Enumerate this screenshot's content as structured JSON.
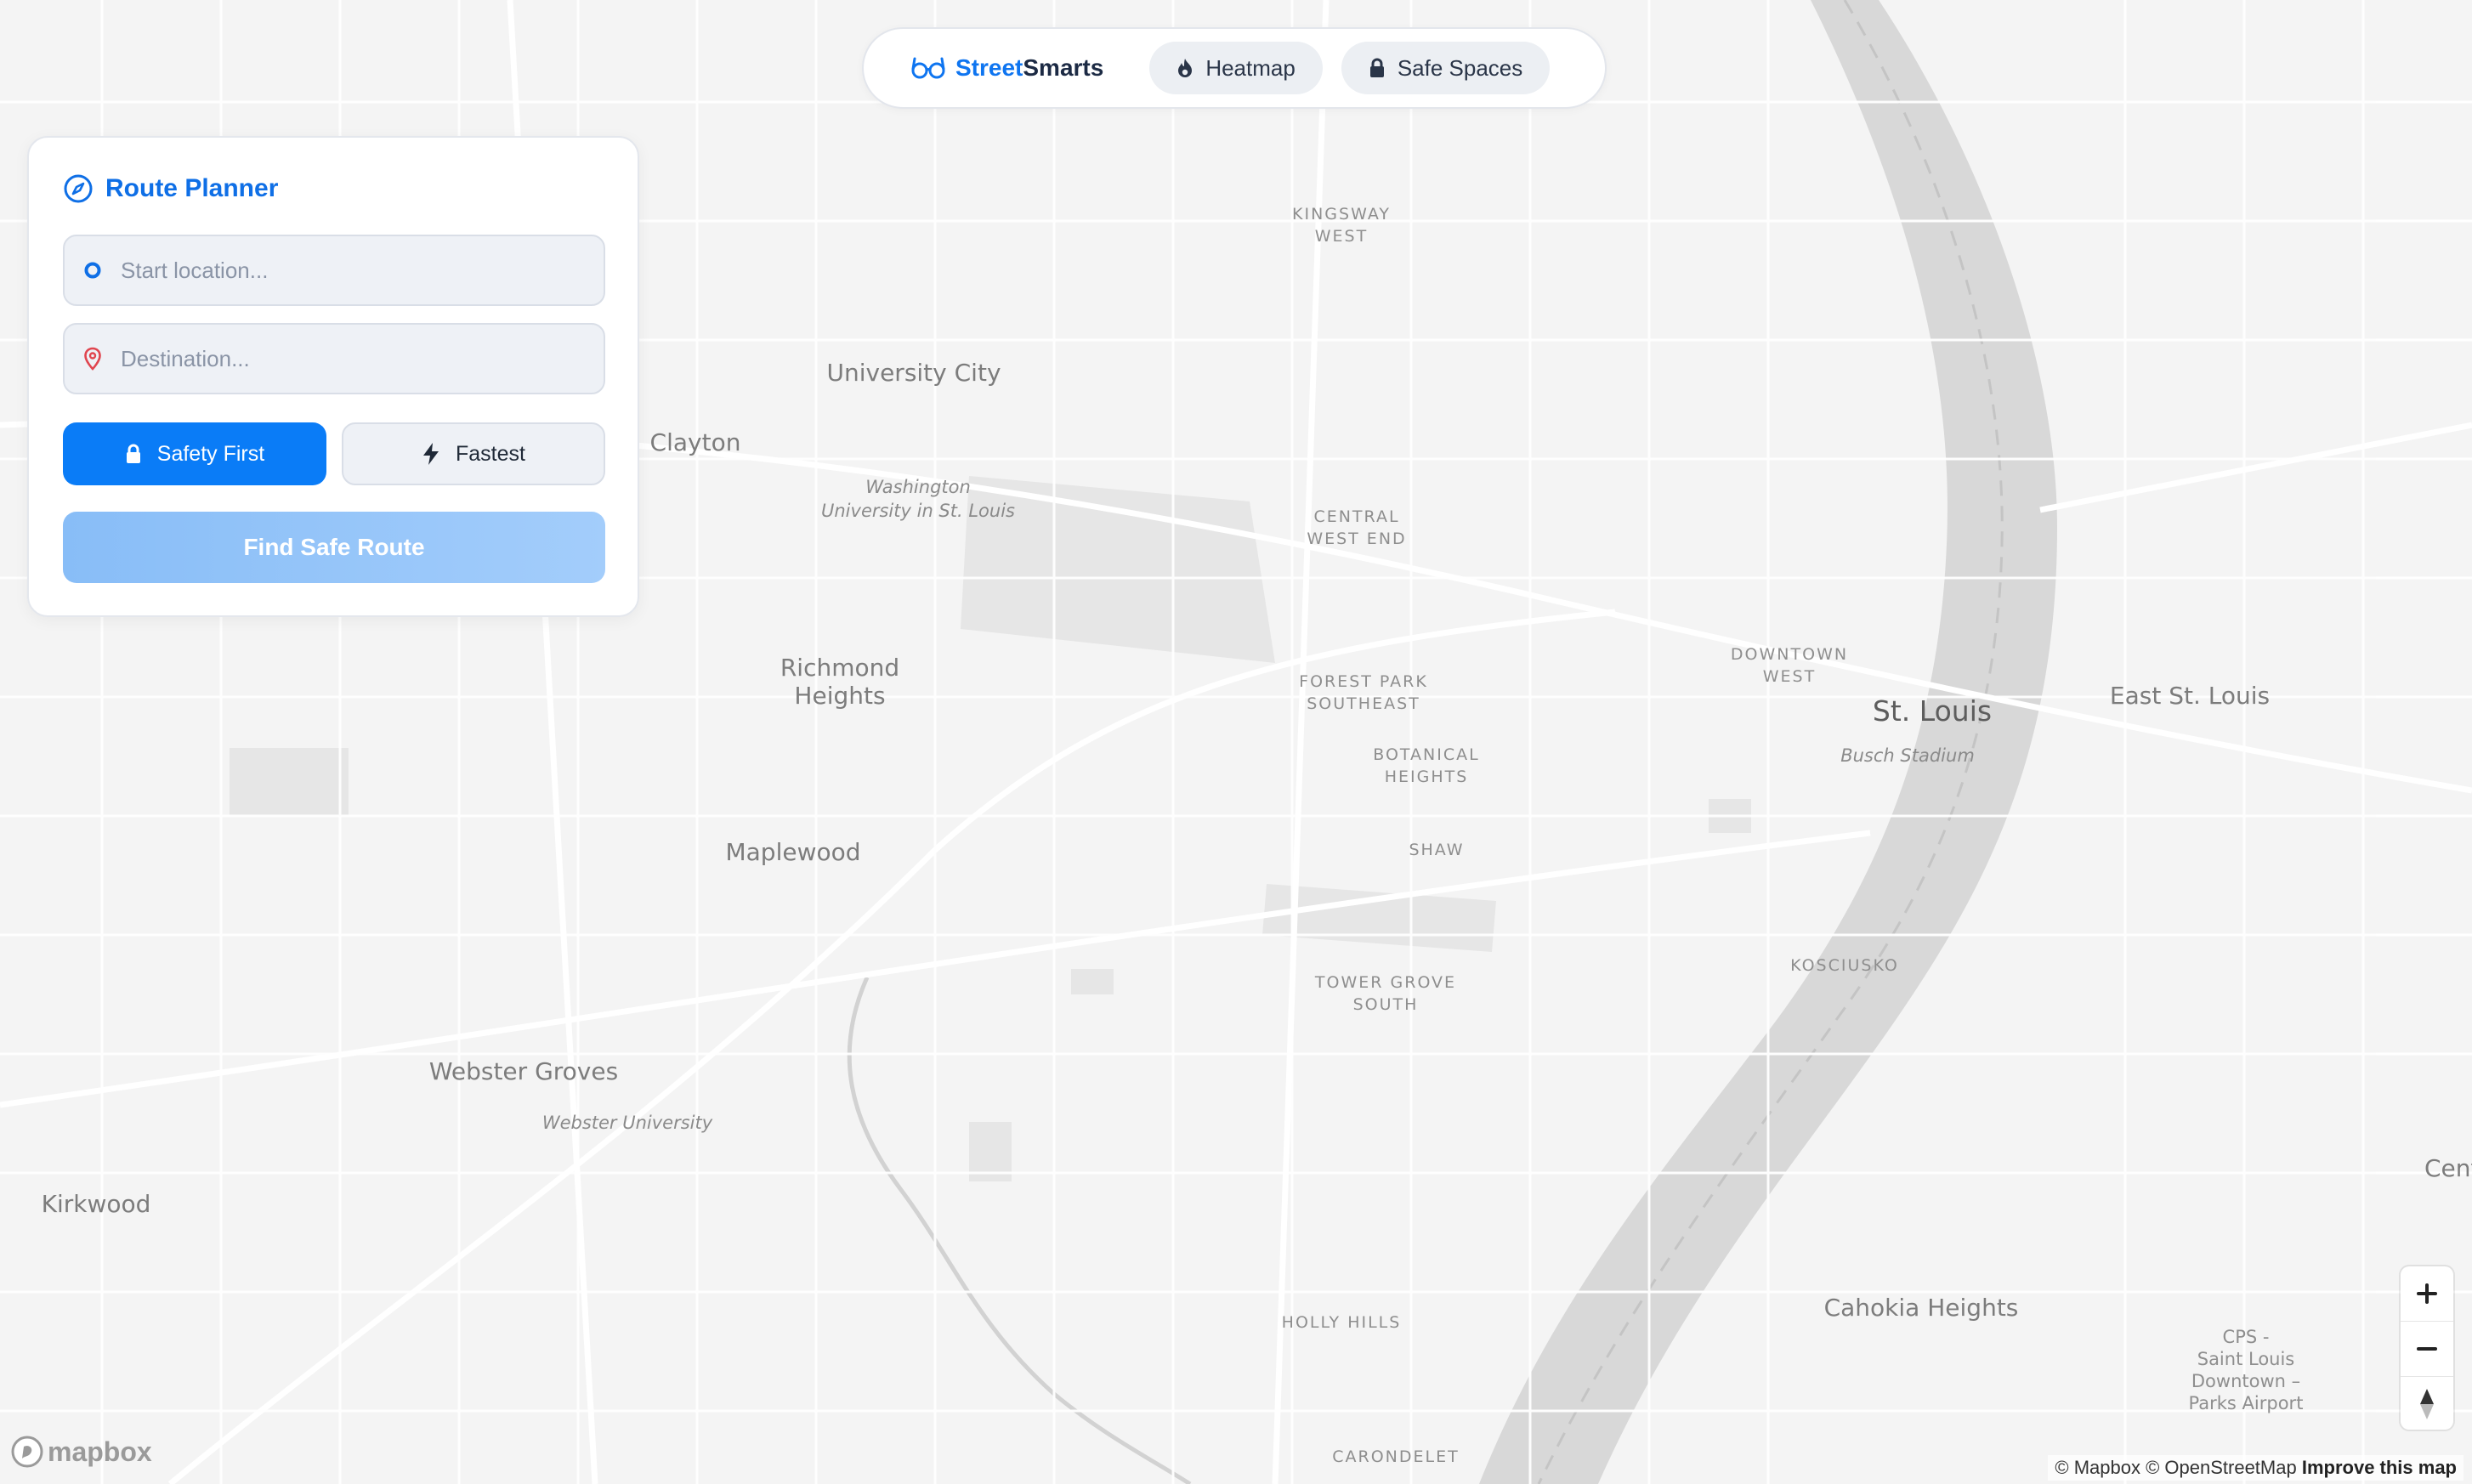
{
  "nav": {
    "brand_part1": "Street",
    "brand_part2": "Smarts",
    "heatmap_label": "Heatmap",
    "safe_spaces_label": "Safe Spaces"
  },
  "planner": {
    "title": "Route Planner",
    "start_placeholder": "Start location...",
    "destination_placeholder": "Destination...",
    "mode_safety": "Safety First",
    "mode_fastest": "Fastest",
    "find_button": "Find Safe Route"
  },
  "map": {
    "labels": {
      "kingsway_1": "KINGSWAY",
      "kingsway_2": "WEST",
      "university_city": "University City",
      "clayton": "Clayton",
      "washu_1": "Washington",
      "washu_2": "University in St. Louis",
      "central_1": "CENTRAL",
      "central_2": "WEST END",
      "richmond_1": "Richmond",
      "richmond_2": "Heights",
      "forest_1": "FOREST PARK",
      "forest_2": "SOUTHEAST",
      "downtown_1": "DOWNTOWN",
      "downtown_2": "WEST",
      "st_louis": "St. Louis",
      "busch": "Busch Stadium",
      "east_st_louis": "East St. Louis",
      "botanical_1": "BOTANICAL",
      "botanical_2": "HEIGHTS",
      "shaw": "SHAW",
      "maplewood": "Maplewood",
      "kosciusko": "KOSCIUSKO",
      "tower_1": "TOWER GROVE",
      "tower_2": "SOUTH",
      "webster_groves": "Webster Groves",
      "webster_univ": "Webster University",
      "kirkwood": "Kirkwood",
      "cent": "Cent",
      "cahokia": "Cahokia Heights",
      "holly": "HOLLY HILLS",
      "carondelet": "CARONDELET",
      "airport_1": "CPS -",
      "airport_2": "Saint Louis",
      "airport_3": "Downtown –",
      "airport_4": "Parks Airport"
    },
    "attribution": "© Mapbox © OpenStreetMap",
    "improve": "Improve this map",
    "logo_text": "mapbox"
  },
  "colors": {
    "brand_blue": "#0f75f0",
    "accent_blue": "#0a7cf7",
    "map_bg": "#f4f4f4",
    "river": "#d6d6d6"
  },
  "icons": {
    "brand": "glasses-icon",
    "heatmap": "flame-icon",
    "safe_spaces": "lock-icon",
    "planner": "compass-icon",
    "start": "circle-dot-icon",
    "destination": "map-pin-icon",
    "safety": "lock-icon",
    "fastest": "bolt-icon"
  }
}
